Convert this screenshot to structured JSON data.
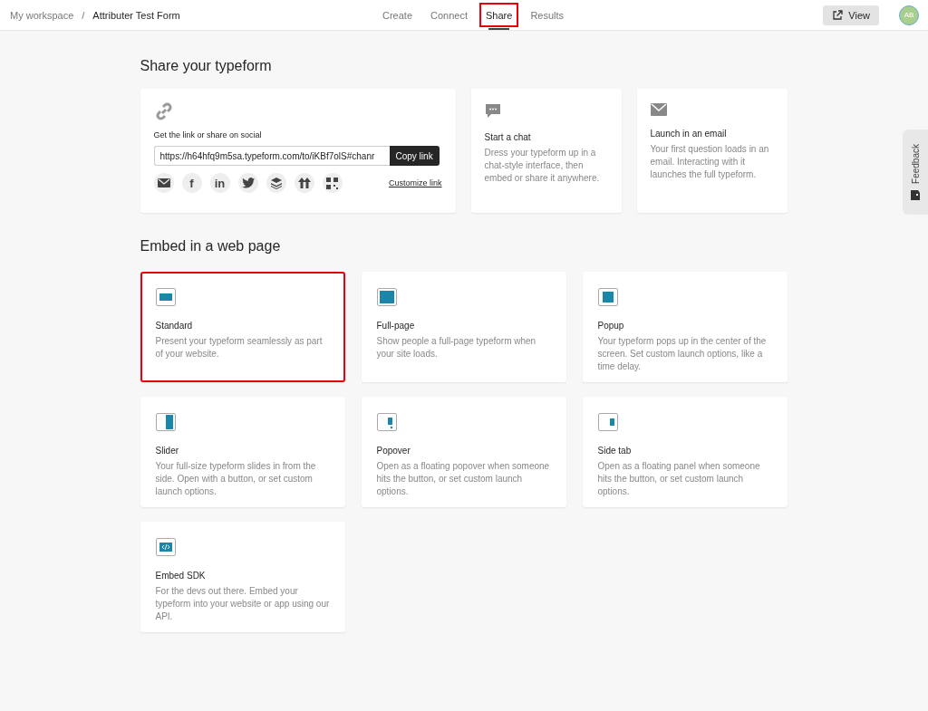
{
  "breadcrumb": {
    "workspace": "My workspace",
    "separator": "/",
    "form": "Attributer Test Form"
  },
  "tabs": [
    {
      "label": "Create",
      "selected": false,
      "highlighted": false
    },
    {
      "label": "Connect",
      "selected": false,
      "highlighted": false
    },
    {
      "label": "Share",
      "selected": true,
      "highlighted": true
    },
    {
      "label": "Results",
      "selected": false,
      "highlighted": false
    }
  ],
  "view_button": "View",
  "avatar": "AB",
  "share_title": "Share your typeform",
  "link_card": {
    "label": "Get the link or share on social",
    "url": "https://h64hfq9m5sa.typeform.com/to/iKBf7olS#chanr",
    "copy_button": "Copy link",
    "customize": "Customize link",
    "social": [
      {
        "kind": "email"
      },
      {
        "kind": "glyph",
        "glyph": "f"
      },
      {
        "kind": "glyph",
        "glyph": "in"
      },
      {
        "kind": "bird"
      },
      {
        "kind": "stack"
      },
      {
        "kind": "arrows"
      },
      {
        "kind": "qr"
      }
    ]
  },
  "share_options": [
    {
      "kind": "chat",
      "title": "Start a chat",
      "description": "Dress your typeform up in a chat-style interface, then embed or share it anywhere."
    },
    {
      "kind": "email",
      "title": "Launch in an email",
      "description": "Your first question loads in an email. Interacting with it launches the full typeform."
    }
  ],
  "embed_title": "Embed in a web page",
  "embed_options": [
    {
      "kind": "standard",
      "title": "Standard",
      "description": "Present your typeform seamlessly as part of your website.",
      "highlighted": true
    },
    {
      "kind": "full-page",
      "title": "Full-page",
      "description": "Show people a full-page typeform when your site loads.",
      "highlighted": false
    },
    {
      "kind": "popup",
      "title": "Popup",
      "description": "Your typeform pops up in the center of the screen. Set custom launch options, like a time delay.",
      "highlighted": false
    },
    {
      "kind": "slider",
      "title": "Slider",
      "description": "Your full-size typeform slides in from the side. Open with a button, or set custom launch options.",
      "highlighted": false
    },
    {
      "kind": "popover",
      "title": "Popover",
      "description": "Open as a floating popover when someone hits the button, or set custom launch options.",
      "highlighted": false
    },
    {
      "kind": "side-tab",
      "title": "Side tab",
      "description": "Open as a floating panel when someone hits the button, or set custom launch options.",
      "highlighted": false
    },
    {
      "kind": "sdk",
      "title": "Embed SDK",
      "description": "For the devs out there. Embed your typeform into your website or app using our API.",
      "highlighted": false
    }
  ],
  "feedback_tab": "Feedback"
}
